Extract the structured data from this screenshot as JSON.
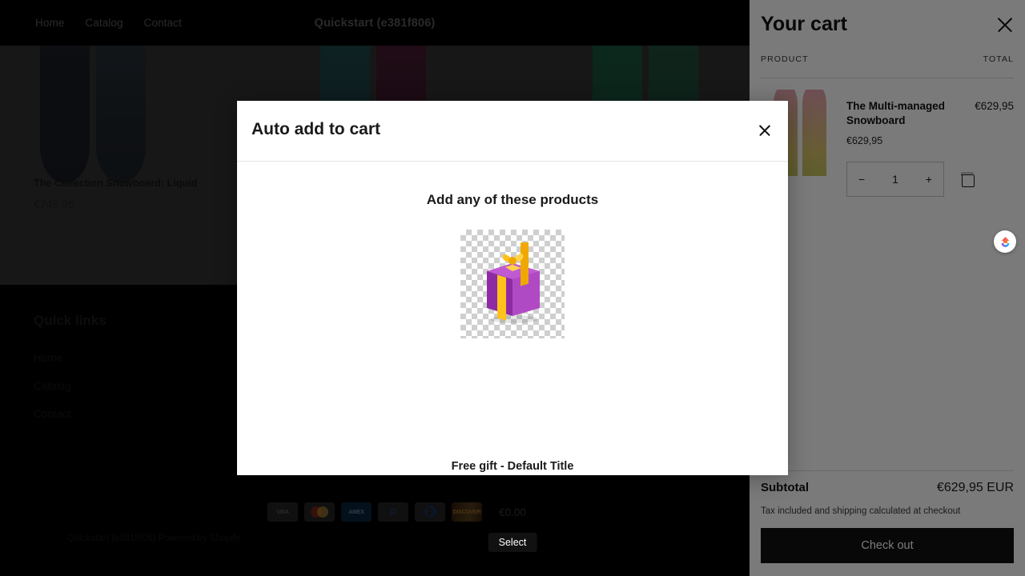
{
  "header": {
    "shop_title": "Quickstart (e381f806)",
    "nav": [
      {
        "label": "Home"
      },
      {
        "label": "Catalog"
      },
      {
        "label": "Contact"
      }
    ]
  },
  "products": [
    {
      "title": "The Collection Snowboard: Liquid",
      "price": "€749,95"
    }
  ],
  "footer": {
    "heading": "Quick links",
    "links": [
      {
        "label": "Home"
      },
      {
        "label": "Catalog"
      },
      {
        "label": "Contact"
      }
    ],
    "payment_icons": [
      {
        "name": "visa-icon",
        "label": "VISA"
      },
      {
        "name": "mastercard-icon",
        "label": ""
      },
      {
        "name": "amex-icon",
        "label": "AMEX"
      },
      {
        "name": "paypal-icon",
        "label": "P"
      },
      {
        "name": "diners-club-icon",
        "label": ""
      },
      {
        "name": "discover-icon",
        "label": "DISCOVER"
      }
    ],
    "copyright": "Quickstart (e381f806) Powered by Shopify"
  },
  "cart": {
    "title": "Your cart",
    "col_product": "PRODUCT",
    "col_total": "TOTAL",
    "item": {
      "name": "The Multi-managed Snowboard",
      "line_total": "€629,95",
      "unit_price": "€629,95",
      "quantity": "1",
      "minus": "−",
      "plus": "+"
    },
    "subtotal_label": "Subtotal",
    "subtotal_value": "€629,95 EUR",
    "tax_note": "Tax included and shipping calculated at checkout",
    "checkout_label": "Check out"
  },
  "modal": {
    "title": "Auto add to cart",
    "subtitle": "Add any of these products",
    "product": {
      "name": "Free gift - Default Title",
      "price": "€0.00",
      "select_label": "Select"
    }
  },
  "colors": {
    "accent_dark": "#121212",
    "gift_box": "#A23CB4",
    "gift_ribbon": "#FFC21A",
    "page_dark": "#000000",
    "overlay_main": "#3d3d3d",
    "overlay_cart": "#7a7a7a"
  }
}
